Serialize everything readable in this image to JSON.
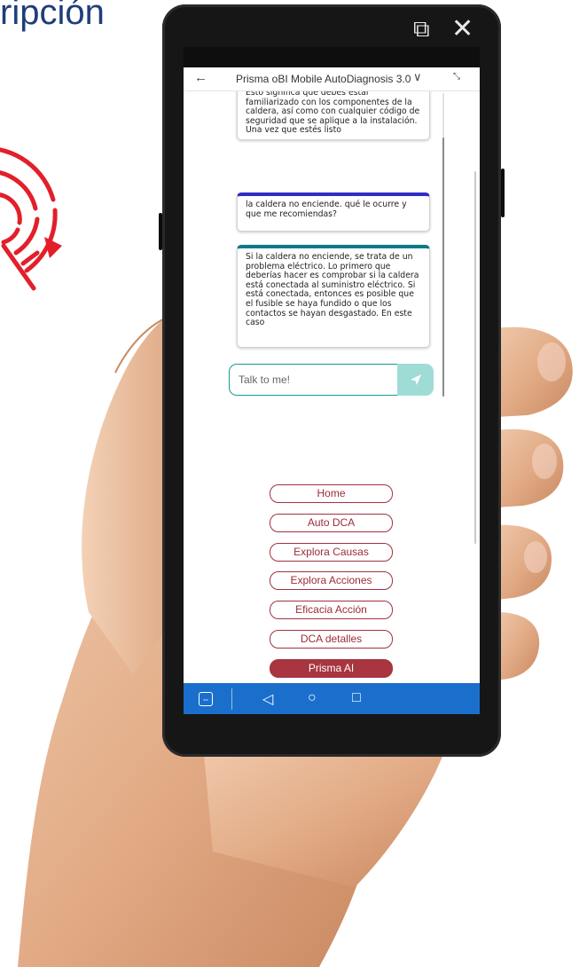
{
  "slide": {
    "heading": "ripción"
  },
  "device": {
    "top_icons": [
      {
        "name": "external-link-icon",
        "glyph": "⧉"
      },
      {
        "name": "close-icon",
        "glyph": "✕"
      }
    ]
  },
  "app": {
    "back_glyph": "←",
    "title": "Prisma oBI Mobile AutoDiagnosis 3.0",
    "chevron_glyph": "∨",
    "minimize_glyph": "⤡"
  },
  "chat": {
    "messages": [
      {
        "role": "bot",
        "text": "Esto significa que debes estar familiarizado con los componentes de la caldera, así como con cualquier código de seguridad que se aplique a la instalación. Una vez que estés listo"
      },
      {
        "role": "user",
        "text": "la caldera no enciende. qué le ocurre y que me recomiendas?"
      },
      {
        "role": "bot",
        "text": "Si la caldera no enciende, se trata de un problema eléctrico. Lo primero que deberías hacer es comprobar si la caldera está conectada al suministro eléctrico. Si está conectada, entonces es posible que el fusible se haya fundido o que los contactos se hayan desgastado. En este caso"
      }
    ],
    "input_placeholder": "Talk to me!",
    "send_icon": "send-icon"
  },
  "nav": {
    "items": [
      "Home",
      "Auto DCA",
      "Explora Causas",
      "Explora Acciones",
      "Eficacia Acción",
      "DCA detalles",
      "Prisma AI"
    ],
    "active_index": 6
  },
  "android_nav": {
    "app_icon": "⇔",
    "back": "◁",
    "home": "○",
    "recent": "□"
  },
  "colors": {
    "heading": "#1f3e79",
    "logo_red": "#e21f2a",
    "accent_teal": "#159a93",
    "send_button": "#9fdcd6",
    "nav_border": "#a23240",
    "nav_active": "#a8353f",
    "android_bar": "#1b6fcc",
    "user_bubble_top": "#2e2ec6",
    "bot_bubble_top": "#0f7a86"
  }
}
